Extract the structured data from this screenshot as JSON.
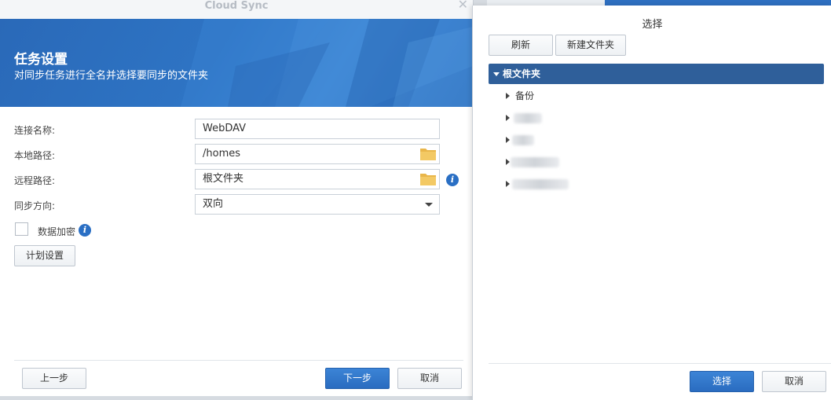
{
  "wizard": {
    "window_title": "Cloud Sync",
    "banner_title": "任务设置",
    "banner_subtitle": "对同步任务进行全名并选择要同步的文件夹",
    "fields": {
      "connection_name_label": "连接名称:",
      "connection_name_value": "WebDAV",
      "local_path_label": "本地路径:",
      "local_path_value": "/homes",
      "remote_path_label": "远程路径:",
      "remote_path_value": "根文件夹",
      "sync_direction_label": "同步方向:",
      "sync_direction_value": "双向"
    },
    "encryption_label": "数据加密",
    "encryption_checked": false,
    "schedule_button": "计划设置",
    "prev_button": "上一步",
    "next_button": "下一步",
    "cancel_button": "取消",
    "info_glyph": "i"
  },
  "dialog": {
    "title": "选择",
    "refresh_button": "刷新",
    "new_folder_button": "新建文件夹",
    "tree": {
      "root_label": "根文件夹",
      "children": [
        "备份"
      ]
    },
    "select_button": "选择",
    "cancel_button": "取消"
  },
  "colors": {
    "banner_blue": "#2e74c4",
    "primary_button": "#2a6cc0",
    "tree_selected": "#2f5f9a",
    "folder_yellow": "#f0c25a"
  }
}
